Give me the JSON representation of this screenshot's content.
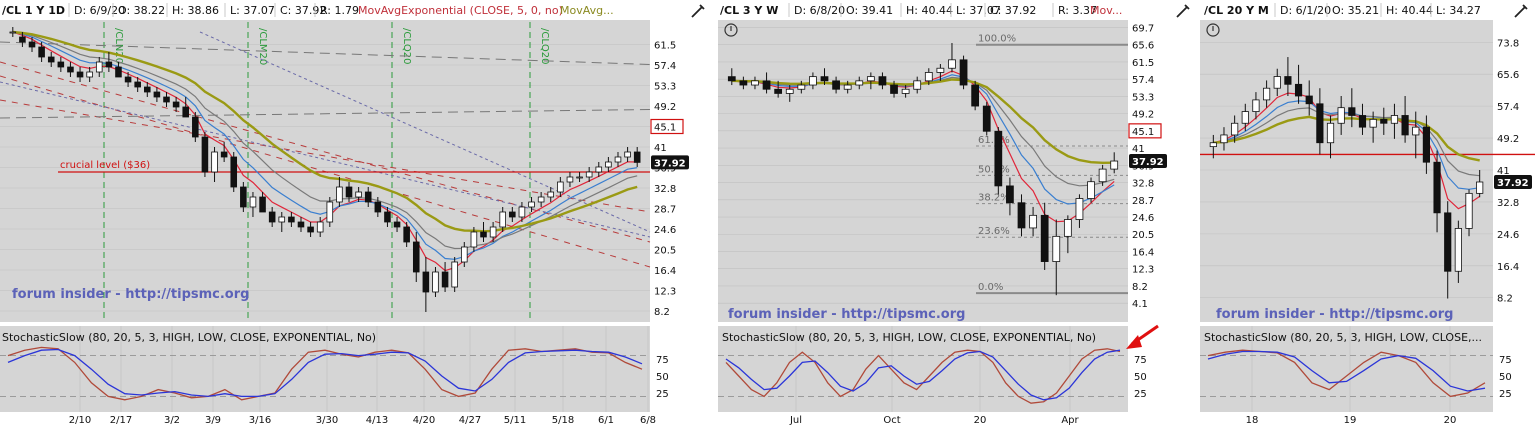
{
  "colors": {
    "plot_bg": "#d5d5d5",
    "divider": "#ffffff",
    "header_bg": "#ffffff",
    "text": "#111111",
    "grid": "#c0c0c0",
    "candle": "#111111",
    "ema_red": "#e0263a",
    "ma_blue": "#3a7fd0",
    "ma_gray": "#7a7a7a",
    "ma_olive": "#9a9a14",
    "stoch_red": "#b04a3a",
    "stoch_blue": "#2b35d8",
    "trend_red": "#b83c3c",
    "trend_gray": "#777777",
    "trend_blue": "#6a6aa8",
    "cycle_green": "#2a9a3a",
    "fib_gray": "#8a8a8a",
    "level_red": "#d01010",
    "price_badge_bg": "#111111",
    "price_badge_text": "#ffffff",
    "arrow_red": "#e01010",
    "watermark": "#5c62b8",
    "header_red": "#c0303a",
    "header_olive": "#8a8a20"
  },
  "panels": [
    {
      "id": "daily",
      "symbol": "/CL 1 Y 1D",
      "header_fields": [
        "D: 6/9/20",
        "O: 38.22",
        "H: 38.86",
        "L: 37.07",
        "C: 37.92",
        "R: 1.79"
      ],
      "study_labels": [
        {
          "text": "MovAvgExponential (CLOSE, 5, 0, no)",
          "color": "red"
        },
        {
          "text": "MovAvg...",
          "color": "olive"
        }
      ],
      "watermark": "forum insider - http://tipsmc.org",
      "stoch_label": "StochasticSlow (80, 20, 5, 3, HIGH, LOW, CLOSE, EXPONENTIAL, No)",
      "price_ticks": [
        "61.5",
        "57.4",
        "53.3",
        "49.2",
        "45.1",
        "41",
        "36.9",
        "32.8",
        "28.7",
        "24.6",
        "20.5",
        "16.4",
        "12.3",
        "8.2"
      ],
      "highlight_tick": "45.1",
      "last_price": "37.92",
      "annotations": [
        {
          "label": "crucial level ($36)",
          "price": 36
        }
      ],
      "cycle_labels": [
        "/CLN20",
        "/CLM20",
        "/CLQ20"
      ],
      "stoch_ticks": [
        "75",
        "50",
        "25"
      ],
      "date_ticks": [
        "2/10",
        "2/17",
        "3/2",
        "3/9",
        "3/16",
        "3/30",
        "4/13",
        "4/20",
        "4/27",
        "5/11",
        "5/18",
        "6/1",
        "6/8"
      ]
    },
    {
      "id": "weekly",
      "symbol": "/CL 3 Y W",
      "header_fields": [
        "D: 6/8/20",
        "O: 39.41",
        "H: 40.44",
        "L: 37.07",
        "C: 37.92",
        "R: 3.37"
      ],
      "study_labels": [
        {
          "text": "Mov...",
          "color": "red"
        }
      ],
      "watermark": "forum insider - http://tipsmc.org",
      "stoch_label": "StochasticSlow (80, 20, 5, 3, HIGH, LOW, CLOSE, EXPONENTIAL, No)",
      "price_ticks": [
        "69.7",
        "65.6",
        "61.5",
        "57.4",
        "53.3",
        "49.2",
        "45.1",
        "41",
        "36.9",
        "32.8",
        "28.7",
        "24.6",
        "20.5",
        "16.4",
        "12.3",
        "8.2",
        "4.1"
      ],
      "highlight_tick": "45.1",
      "last_price": "37.92",
      "fib_labels": [
        "100.0%",
        "61.8%",
        "50.0%",
        "38.2%",
        "23.6%",
        "0.0%"
      ],
      "stoch_ticks": [
        "75",
        "50",
        "25"
      ],
      "date_ticks": [
        "Jul",
        "Oct",
        "20",
        "Apr"
      ]
    },
    {
      "id": "monthly",
      "symbol": "/CL 20 Y M",
      "header_fields": [
        "D: 6/1/20",
        "O: 35.21",
        "H: 40.44",
        "L: 34.27"
      ],
      "study_labels": [],
      "watermark": "forum insider - http://tipsmc.org",
      "stoch_label": "StochasticSlow (80, 20, 5, 3, HIGH, LOW, CLOSE, EXPONENTIAL, No)",
      "stoch_label_truncated": "StochasticSlow (80, 20, 5, 3, HIGH, LOW, CLOSE,...",
      "price_ticks": [
        "73.8",
        "65.6",
        "57.4",
        "49.2",
        "41",
        "32.8",
        "24.6",
        "16.4",
        "8.2"
      ],
      "last_price": "37.92",
      "stoch_ticks": [
        "75",
        "50",
        "25"
      ],
      "date_ticks": [
        "18",
        "19",
        "20"
      ]
    }
  ],
  "chart_data": [
    {
      "type": "candlestick",
      "title": "/CL 1 Y 1D",
      "ylim": [
        6,
        66
      ],
      "last_close": 37.92,
      "horizontal_levels": [
        {
          "label": "crucial level ($36)",
          "value": 36
        }
      ],
      "ohlc": [
        [
          64,
          65,
          63,
          64
        ],
        [
          63,
          64,
          61,
          62
        ],
        [
          62,
          63,
          60,
          61
        ],
        [
          61,
          62,
          58,
          59
        ],
        [
          59,
          60,
          57,
          58
        ],
        [
          58,
          59,
          56,
          57
        ],
        [
          57,
          58,
          55,
          56
        ],
        [
          56,
          57,
          54,
          55
        ],
        [
          55,
          57,
          54,
          56
        ],
        [
          56,
          59,
          55,
          58
        ],
        [
          58,
          60,
          56,
          57
        ],
        [
          57,
          58,
          55,
          55
        ],
        [
          55,
          56,
          53,
          54
        ],
        [
          54,
          55,
          52,
          53
        ],
        [
          53,
          54,
          51,
          52
        ],
        [
          52,
          53,
          50,
          51
        ],
        [
          51,
          52,
          49,
          50
        ],
        [
          50,
          51,
          48,
          49
        ],
        [
          49,
          51,
          47,
          47
        ],
        [
          47,
          48,
          42,
          43
        ],
        [
          43,
          44,
          35,
          36
        ],
        [
          36,
          41,
          34,
          40
        ],
        [
          40,
          42,
          38,
          39
        ],
        [
          39,
          40,
          32,
          33
        ],
        [
          33,
          34,
          28,
          29
        ],
        [
          29,
          32,
          27,
          31
        ],
        [
          31,
          32,
          28,
          28
        ],
        [
          28,
          29,
          25,
          26
        ],
        [
          26,
          28,
          24,
          27
        ],
        [
          27,
          28,
          25,
          26
        ],
        [
          26,
          27,
          24,
          25
        ],
        [
          25,
          26,
          23,
          24
        ],
        [
          24,
          27,
          23,
          26
        ],
        [
          26,
          31,
          25,
          30
        ],
        [
          30,
          35,
          29,
          33
        ],
        [
          33,
          34,
          30,
          31
        ],
        [
          31,
          33,
          30,
          32
        ],
        [
          32,
          33,
          29,
          30
        ],
        [
          30,
          31,
          27,
          28
        ],
        [
          28,
          29,
          25,
          26
        ],
        [
          26,
          27,
          24,
          25
        ],
        [
          25,
          26,
          21,
          22
        ],
        [
          22,
          24,
          14,
          16
        ],
        [
          16,
          19,
          8,
          12
        ],
        [
          12,
          17,
          11,
          16
        ],
        [
          16,
          18,
          12,
          13
        ],
        [
          13,
          19,
          12,
          18
        ],
        [
          18,
          22,
          17,
          21
        ],
        [
          21,
          25,
          20,
          24
        ],
        [
          24,
          26,
          22,
          23
        ],
        [
          23,
          26,
          22,
          25
        ],
        [
          25,
          29,
          24,
          28
        ],
        [
          28,
          29,
          26,
          27
        ],
        [
          27,
          30,
          26,
          29
        ],
        [
          29,
          31,
          28,
          30
        ],
        [
          30,
          32,
          29,
          31
        ],
        [
          31,
          33,
          30,
          32
        ],
        [
          32,
          35,
          31,
          34
        ],
        [
          34,
          36,
          33,
          35
        ],
        [
          35,
          36,
          34,
          35
        ],
        [
          35,
          37,
          34,
          36
        ],
        [
          36,
          38,
          35,
          37
        ],
        [
          37,
          39,
          36,
          38
        ],
        [
          38,
          40,
          37,
          39
        ],
        [
          39,
          41,
          38,
          40
        ],
        [
          40,
          41,
          37,
          37.92
        ]
      ],
      "stoch_k": [
        80,
        88,
        92,
        90,
        70,
        40,
        20,
        15,
        20,
        30,
        25,
        18,
        20,
        30,
        15,
        20,
        25,
        60,
        85,
        88,
        82,
        78,
        85,
        88,
        84,
        60,
        30,
        20,
        25,
        60,
        88,
        90,
        86,
        88,
        90,
        85,
        84,
        70,
        60
      ],
      "stoch_d": [
        70,
        80,
        88,
        89,
        80,
        60,
        38,
        24,
        22,
        25,
        27,
        22,
        20,
        24,
        20,
        20,
        24,
        45,
        70,
        82,
        83,
        80,
        82,
        85,
        84,
        72,
        50,
        32,
        28,
        45,
        70,
        84,
        86,
        87,
        88,
        86,
        85,
        78,
        68
      ],
      "stoch_ylim": [
        0,
        100
      ],
      "xlabel": "",
      "ylabel": ""
    },
    {
      "type": "candlestick",
      "title": "/CL 3 Y W",
      "ylim": [
        2,
        71
      ],
      "last_close": 37.92,
      "fibonacci": [
        {
          "label": "100.0%",
          "value": 65.6
        },
        {
          "label": "61.8%",
          "value": 41.5
        },
        {
          "label": "50.0%",
          "value": 34.5
        },
        {
          "label": "38.2%",
          "value": 27.8
        },
        {
          "label": "23.6%",
          "value": 19.8
        },
        {
          "label": "0.0%",
          "value": 6.5
        }
      ],
      "ohlc": [
        [
          58,
          60,
          56,
          57
        ],
        [
          57,
          58,
          55,
          56
        ],
        [
          56,
          58,
          55,
          57
        ],
        [
          57,
          59,
          54,
          55
        ],
        [
          55,
          57,
          53,
          54
        ],
        [
          54,
          56,
          52,
          55
        ],
        [
          55,
          57,
          54,
          56
        ],
        [
          56,
          59,
          55,
          58
        ],
        [
          58,
          60,
          56,
          57
        ],
        [
          57,
          58,
          54,
          55
        ],
        [
          55,
          57,
          54,
          56
        ],
        [
          56,
          58,
          55,
          57
        ],
        [
          57,
          59,
          55,
          58
        ],
        [
          58,
          59,
          55,
          56
        ],
        [
          56,
          57,
          53,
          54
        ],
        [
          54,
          56,
          53,
          55
        ],
        [
          55,
          58,
          54,
          57
        ],
        [
          57,
          60,
          56,
          59
        ],
        [
          59,
          61,
          57,
          60
        ],
        [
          60,
          66,
          59,
          62
        ],
        [
          62,
          63,
          55,
          56
        ],
        [
          56,
          57,
          50,
          51
        ],
        [
          51,
          52,
          44,
          45
        ],
        [
          45,
          46,
          30,
          32
        ],
        [
          32,
          34,
          25,
          28
        ],
        [
          28,
          30,
          20,
          22
        ],
        [
          22,
          27,
          20,
          25
        ],
        [
          25,
          28,
          12,
          14
        ],
        [
          14,
          24,
          6,
          20
        ],
        [
          20,
          25,
          16,
          24
        ],
        [
          24,
          30,
          22,
          29
        ],
        [
          29,
          34,
          28,
          33
        ],
        [
          33,
          37,
          32,
          36
        ],
        [
          36,
          40,
          35,
          37.92
        ]
      ],
      "stoch_k": [
        70,
        50,
        30,
        20,
        40,
        70,
        85,
        70,
        40,
        20,
        30,
        60,
        80,
        60,
        40,
        30,
        50,
        70,
        85,
        88,
        86,
        70,
        40,
        20,
        10,
        12,
        25,
        50,
        75,
        88,
        90,
        86
      ],
      "stoch_d": [
        75,
        62,
        45,
        30,
        32,
        50,
        70,
        72,
        55,
        35,
        28,
        40,
        62,
        65,
        50,
        38,
        42,
        58,
        75,
        84,
        86,
        78,
        58,
        38,
        22,
        15,
        18,
        32,
        55,
        75,
        85,
        88
      ],
      "stoch_ylim": [
        0,
        100
      ],
      "xlabel": "",
      "ylabel": ""
    },
    {
      "type": "candlestick",
      "title": "/CL 20 Y M",
      "ylim": [
        3,
        79
      ],
      "last_close": 37.92,
      "horizontal_levels": [
        {
          "label": "",
          "value": 45
        }
      ],
      "ohlc": [
        [
          47,
          50,
          44,
          48
        ],
        [
          48,
          52,
          46,
          50
        ],
        [
          50,
          55,
          48,
          53
        ],
        [
          53,
          58,
          51,
          56
        ],
        [
          56,
          61,
          54,
          59
        ],
        [
          59,
          64,
          57,
          62
        ],
        [
          62,
          67,
          60,
          65
        ],
        [
          65,
          70,
          60,
          63
        ],
        [
          63,
          68,
          58,
          60
        ],
        [
          60,
          64,
          55,
          58
        ],
        [
          58,
          62,
          45,
          48
        ],
        [
          48,
          55,
          44,
          53
        ],
        [
          53,
          60,
          50,
          57
        ],
        [
          57,
          62,
          52,
          55
        ],
        [
          55,
          58,
          50,
          52
        ],
        [
          52,
          56,
          48,
          54
        ],
        [
          54,
          57,
          50,
          53
        ],
        [
          53,
          58,
          49,
          55
        ],
        [
          55,
          60,
          48,
          50
        ],
        [
          50,
          56,
          44,
          52
        ],
        [
          52,
          55,
          40,
          43
        ],
        [
          43,
          46,
          25,
          30
        ],
        [
          30,
          33,
          8,
          15
        ],
        [
          15,
          28,
          12,
          26
        ],
        [
          26,
          36,
          24,
          35
        ],
        [
          35,
          41,
          34,
          37.92
        ]
      ],
      "stoch_k": [
        80,
        85,
        88,
        86,
        84,
        70,
        40,
        30,
        50,
        70,
        85,
        80,
        70,
        40,
        20,
        25,
        40
      ],
      "stoch_d": [
        75,
        82,
        86,
        86,
        85,
        78,
        58,
        40,
        42,
        58,
        75,
        80,
        76,
        58,
        35,
        28,
        32
      ],
      "stoch_ylim": [
        0,
        100
      ],
      "xlabel": "",
      "ylabel": ""
    }
  ]
}
